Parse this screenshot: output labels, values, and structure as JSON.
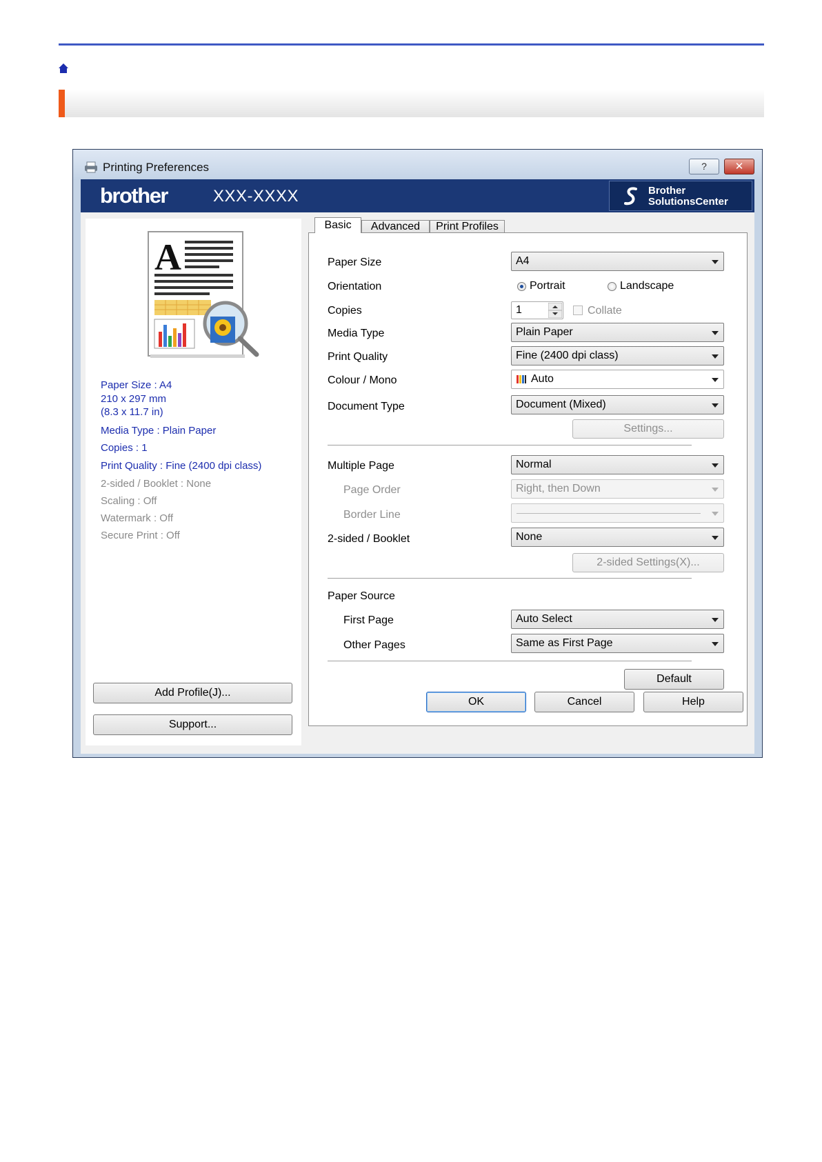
{
  "dialog": {
    "title": "Printing Preferences",
    "help_glyph": "?",
    "close_glyph": "✕",
    "brand": "brother",
    "model": "XXX-XXXX",
    "solutions_line1": "Brother",
    "solutions_line2": "SolutionsCenter"
  },
  "summary": {
    "paper_size": "Paper Size : A4",
    "dimensions_mm": "210 x 297 mm",
    "dimensions_in": "(8.3 x 11.7 in)",
    "media_type": "Media Type : Plain Paper",
    "copies": "Copies : 1",
    "print_quality": "Print Quality : Fine (2400 dpi class)",
    "two_sided": "2-sided / Booklet : None",
    "scaling": "Scaling : Off",
    "watermark": "Watermark : Off",
    "secure_print": "Secure Print : Off"
  },
  "left_buttons": {
    "add_profile": "Add Profile(J)...",
    "support": "Support..."
  },
  "tabs": [
    "Basic",
    "Advanced",
    "Print Profiles"
  ],
  "basic": {
    "paper_size": {
      "label": "Paper Size",
      "value": "A4"
    },
    "orientation": {
      "label": "Orientation",
      "portrait": "Portrait",
      "landscape": "Landscape",
      "selected": "Portrait"
    },
    "copies": {
      "label": "Copies",
      "value": "1",
      "collate": "Collate",
      "collate_checked": false
    },
    "media_type": {
      "label": "Media Type",
      "value": "Plain Paper"
    },
    "print_quality": {
      "label": "Print Quality",
      "value": "Fine (2400 dpi class)"
    },
    "colour_mono": {
      "label": "Colour / Mono",
      "value": "Auto"
    },
    "document_type": {
      "label": "Document Type",
      "value": "Document (Mixed)",
      "settings_button": "Settings..."
    },
    "multiple_page": {
      "label": "Multiple Page",
      "value": "Normal"
    },
    "page_order": {
      "label": "Page Order",
      "value": "Right, then Down"
    },
    "border_line": {
      "label": "Border Line"
    },
    "two_sided": {
      "label": "2-sided / Booklet",
      "value": "None",
      "settings_button": "2-sided Settings(X)..."
    },
    "paper_source": {
      "label": "Paper Source"
    },
    "first_page": {
      "label": "First Page",
      "value": "Auto Select"
    },
    "other_pages": {
      "label": "Other Pages",
      "value": "Same as First Page"
    },
    "default_button": "Default"
  },
  "footer_buttons": {
    "ok": "OK",
    "cancel": "Cancel",
    "help": "Help"
  },
  "colors": {
    "accent_bar": "#ef5a1a",
    "top_rule": "#3f59c4",
    "brand_bar": "#1b3876",
    "summary_text": "#1c2dae"
  }
}
